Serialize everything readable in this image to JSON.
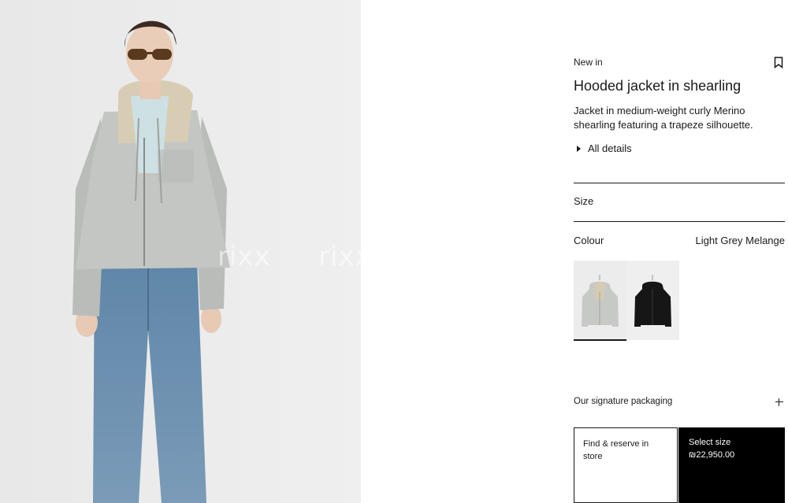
{
  "hero": {
    "watermark": [
      "rixx",
      "rixx"
    ]
  },
  "product": {
    "eyebrow": "New in",
    "title": "Hooded jacket in shearling",
    "description": "Jacket in medium-weight curly Merino shearling featuring a trapeze silhouette.",
    "details_label": "All details"
  },
  "size": {
    "label": "Size"
  },
  "colour": {
    "label": "Colour",
    "selected": "Light Grey Melange",
    "swatches": [
      {
        "name": "Light Grey Melange",
        "color": "#c7c9c6",
        "selected": true
      },
      {
        "name": "Black",
        "color": "#161616",
        "selected": false
      }
    ]
  },
  "packaging": {
    "label": "Our signature packaging"
  },
  "actions": {
    "store_label": "Find & reserve in store",
    "select_size_label": "Select size",
    "price": "₪22,950.00"
  },
  "colors": {
    "text": "#1a1a1a",
    "cta_bg": "#000000",
    "image_bg": "#ececec"
  }
}
